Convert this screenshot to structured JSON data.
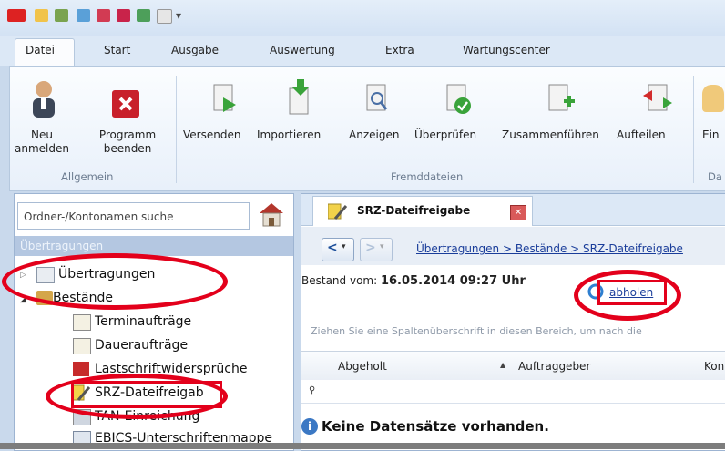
{
  "tabs": [
    "Datei",
    "Start",
    "Ausgabe",
    "Auswertung",
    "Extra",
    "Wartungscenter"
  ],
  "ribbon": {
    "allgemein": {
      "name": "Allgemein",
      "neu": "Neu\nanmelden",
      "beenden": "Programm\nbeenden"
    },
    "fremddateien": {
      "name": "Fremddateien",
      "buttons": [
        "Versenden",
        "Importieren",
        "Anzeigen",
        "Überprüfen",
        "Zusammenführen",
        "Aufteilen"
      ]
    },
    "partial_label": "Ein",
    "partial_group": "Da"
  },
  "left": {
    "search_placeholder": "Ordner-/Kontonamen suche",
    "header": "Übertragungen",
    "tree": {
      "uebertragungen": "Übertragungen",
      "bestaende": "Bestände",
      "termin": "Terminaufträge",
      "dauer": "Daueraufträge",
      "lastschrift": "Lastschriftwidersprüche",
      "srz": "SRZ-Dateifreigab",
      "tan": "TAN-Einreichung",
      "ebics": "EBICS-Unterschriftenmappe"
    }
  },
  "right": {
    "tab_title": "SRZ-Dateifreigabe",
    "breadcrumb": "Übertragungen > Bestände > SRZ-Dateifreigabe",
    "bestand_label": "Bestand vom:",
    "bestand_date": "16.05.2014 09:27 Uhr",
    "abholen": "abholen",
    "group_hint": "Ziehen Sie eine Spaltenüberschrift in diesen Bereich, um nach die",
    "columns": [
      "Abgeholt",
      "Auftraggeber",
      "Kon"
    ],
    "empty": "Keine Datensätze vorhanden."
  },
  "colors": {
    "annotation": "#e3001b",
    "link": "#1a3d9a"
  }
}
